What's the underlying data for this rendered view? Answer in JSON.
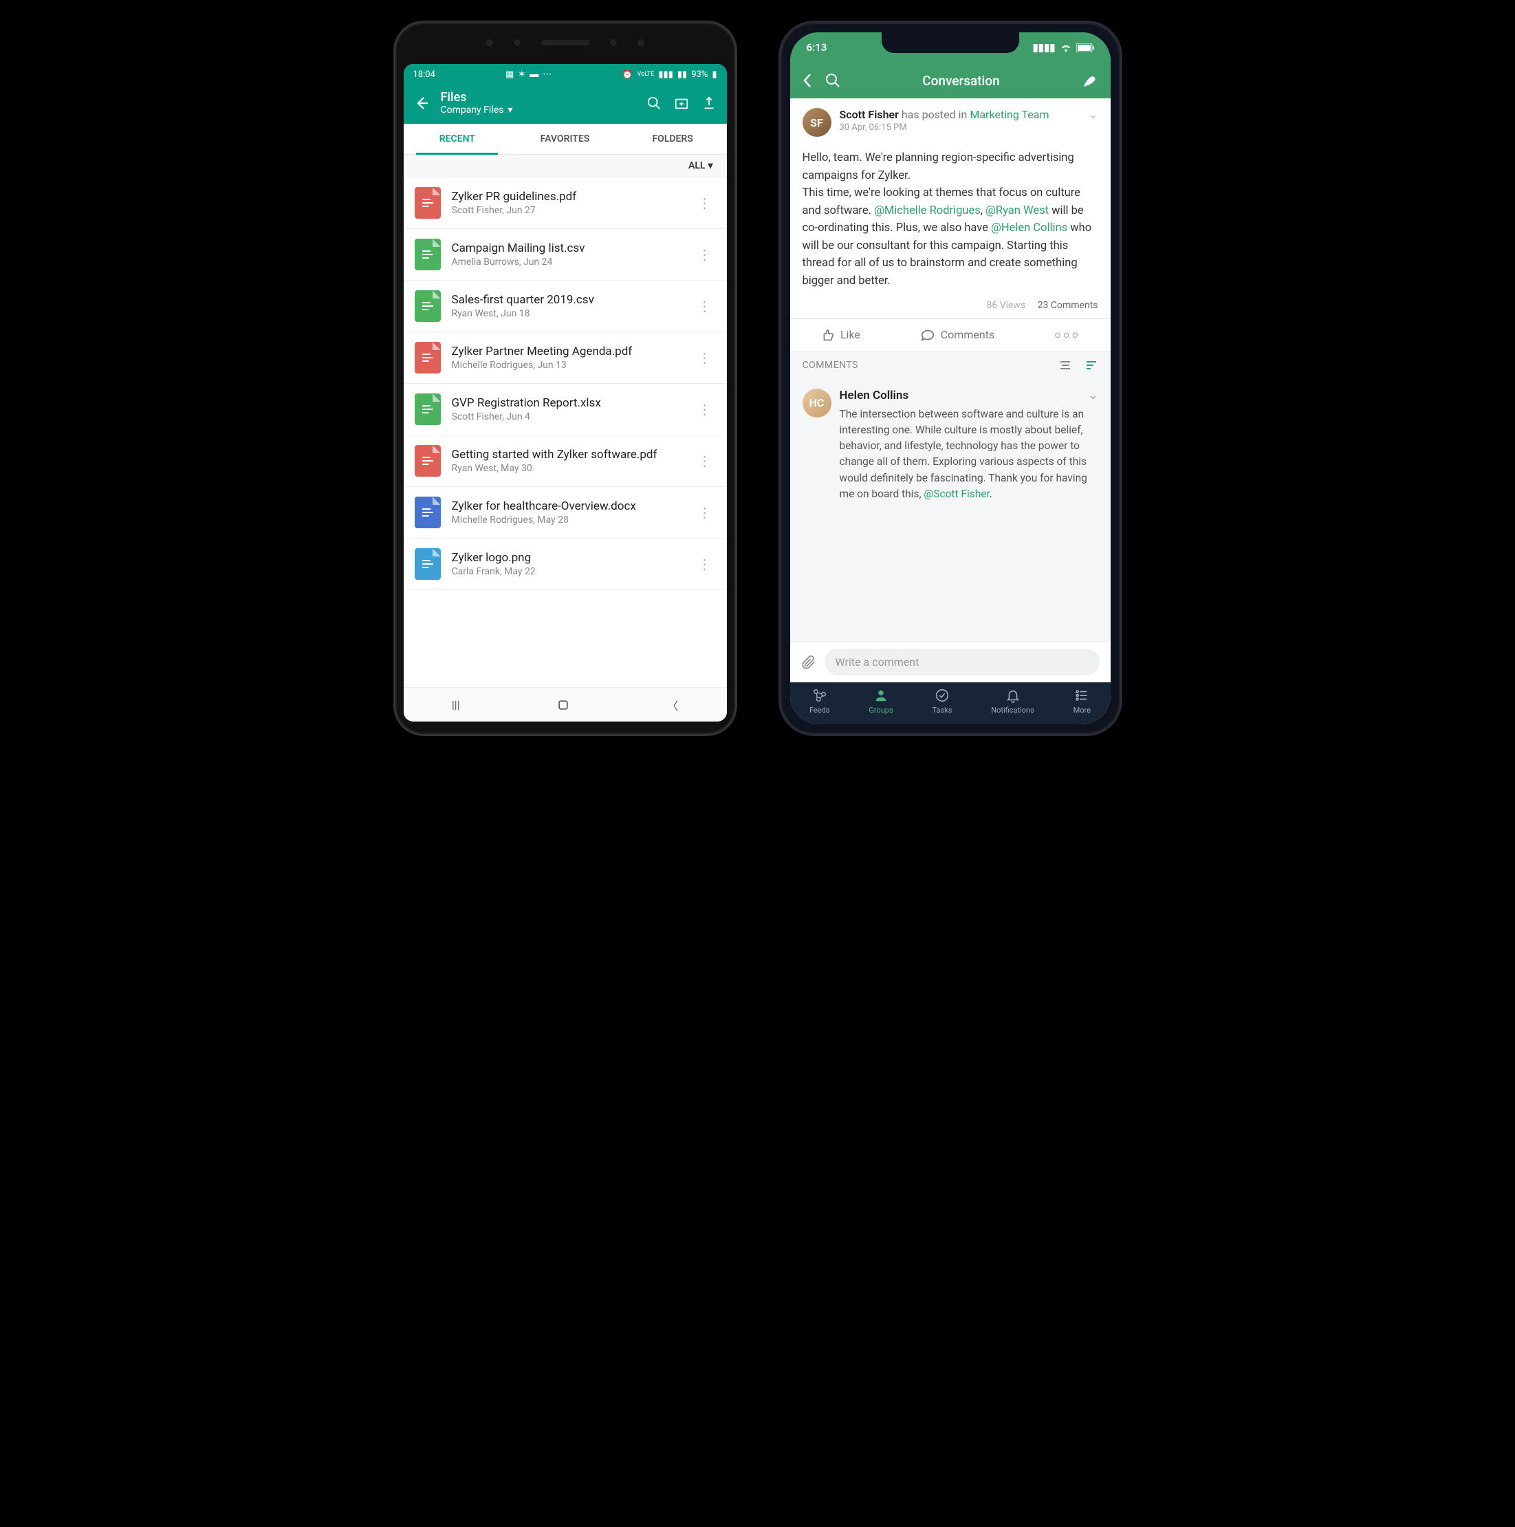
{
  "android": {
    "status": {
      "time": "18:04",
      "battery": "93%"
    },
    "header": {
      "title": "Files",
      "subtitle": "Company Files"
    },
    "tabs": [
      "RECENT",
      "FAVORITES",
      "FOLDERS"
    ],
    "active_tab_index": 0,
    "filter_label": "ALL",
    "files": [
      {
        "name": "Zylker PR guidelines.pdf",
        "sub": "Scott Fisher, Jun 27",
        "kind": "pdf"
      },
      {
        "name": "Campaign Mailing list.csv",
        "sub": "Amelia Burrows, Jun 24",
        "kind": "csv"
      },
      {
        "name": "Sales-first quarter 2019.csv",
        "sub": "Ryan West, Jun 18",
        "kind": "csv"
      },
      {
        "name": "Zylker Partner Meeting Agenda.pdf",
        "sub": "Michelle Rodrigues, Jun 13",
        "kind": "pdf"
      },
      {
        "name": "GVP Registration Report.xlsx",
        "sub": "Scott Fisher, Jun 4",
        "kind": "xlsx"
      },
      {
        "name": "Getting started with Zylker software.pdf",
        "sub": "Ryan West, May 30",
        "kind": "pdf"
      },
      {
        "name": "Zylker for healthcare-Overview.docx",
        "sub": "Michelle Rodrigues, May 28",
        "kind": "docx"
      },
      {
        "name": "Zylker logo.png",
        "sub": "Carla Frank, May 22",
        "kind": "png"
      }
    ],
    "file_colors": {
      "pdf": "#e06057",
      "csv": "#4cb25f",
      "xlsx": "#4cb25f",
      "docx": "#4573d2",
      "png": "#3ea0d6"
    }
  },
  "ios": {
    "status": {
      "time": "6:13"
    },
    "header": {
      "title": "Conversation"
    },
    "post": {
      "author": "Scott Fisher",
      "action": "has posted in",
      "group": "Marketing Team",
      "date": "30 Apr, 06:15 PM",
      "body_parts": [
        {
          "t": "Hello, team. We're planning region-specific advertising campaigns for Zylker."
        },
        {
          "br": true
        },
        {
          "t": "This time, we're looking at themes that focus on culture and software. "
        },
        {
          "m": "@Michelle Rodrigues"
        },
        {
          "t": ", "
        },
        {
          "m": "@Ryan West"
        },
        {
          "t": " will be co-ordinating this. Plus, we also have "
        },
        {
          "m": "@Helen Collins"
        },
        {
          "t": " who will be our consultant for this campaign. Starting this thread for all of us to brainstorm and create something bigger and better."
        }
      ],
      "views": "86 Views",
      "comments_count": "23 Comments"
    },
    "actions": {
      "like": "Like",
      "comments": "Comments"
    },
    "comments_header": "COMMENTS",
    "comment": {
      "author": "Helen Collins",
      "body_parts": [
        {
          "t": "The intersection between software and culture is an interesting one. While culture is mostly about belief, behavior, and lifestyle, technology has the power to change all of them. Exploring various aspects of this would definitely be fascinating. Thank you for having me on board this, "
        },
        {
          "m": "@Scott Fisher"
        },
        {
          "t": "."
        }
      ]
    },
    "input_placeholder": "Write a comment",
    "bottom_nav": [
      {
        "label": "Feeds",
        "icon": "feeds"
      },
      {
        "label": "Groups",
        "icon": "groups",
        "active": true
      },
      {
        "label": "Tasks",
        "icon": "tasks"
      },
      {
        "label": "Notifications",
        "icon": "bell"
      },
      {
        "label": "More",
        "icon": "more"
      }
    ]
  }
}
